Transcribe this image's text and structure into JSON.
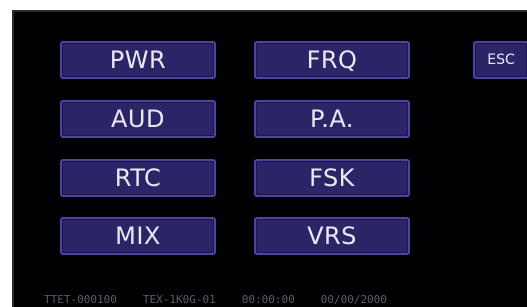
{
  "buttons": {
    "pwr": "PWR",
    "frq": "FRQ",
    "aud": "AUD",
    "pa": "P.A.",
    "rtc": "RTC",
    "fsk": "FSK",
    "mix": "MIX",
    "vrs": "VRS",
    "esc": "ESC"
  },
  "status": {
    "unit_id": "TTET-000100",
    "model": "TEX-1K0G-01",
    "time": "00:00:00",
    "date": "00/00/2000"
  },
  "colors": {
    "screen_background": "#010103",
    "button_fill": "#2b2466",
    "button_border": "#4c44a0",
    "button_text": "#e9e9f2",
    "status_text": "#5c5c66"
  }
}
